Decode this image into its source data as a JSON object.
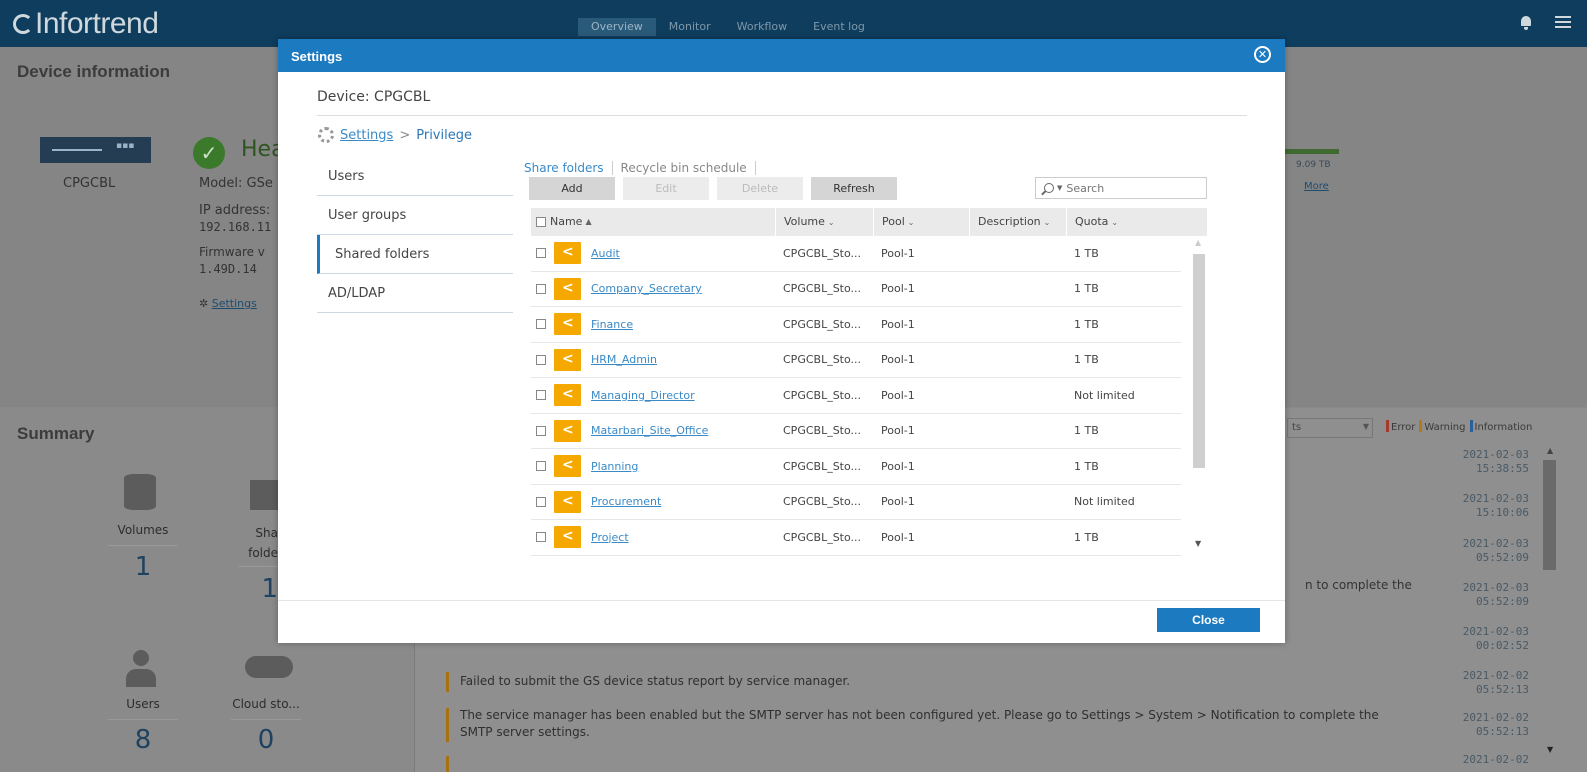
{
  "app": {
    "brand": "Infortrend",
    "nav": [
      "Overview",
      "Monitor",
      "Workflow",
      "Event log"
    ],
    "active_nav": "Overview"
  },
  "background": {
    "device_info_title": "Device information",
    "device_name": "CPGCBL",
    "health_label": "Hea",
    "model": "Model: GSe",
    "ip_label": "IP address:",
    "ip_value": "192.168.11",
    "firmware_label": "Firmware v",
    "firmware_value": "1.49D.14",
    "settings_link": "Settings",
    "capacity": "9.09 TB",
    "more_link": "More",
    "summary_title": "Summary",
    "stats": [
      {
        "label": "Volumes",
        "value": "1"
      },
      {
        "label": "Sha folde",
        "value": "1"
      },
      {
        "label": "Users",
        "value": "8"
      },
      {
        "label": "Cloud sto...",
        "value": "0"
      }
    ],
    "event_filter": "ts",
    "legend": {
      "error": "Error",
      "warning": "Warning",
      "information": "Information"
    },
    "event_times": [
      {
        "date": "2021-02-03",
        "time": "15:38:55"
      },
      {
        "date": "2021-02-03",
        "time": "15:10:06"
      },
      {
        "date": "2021-02-03",
        "time": "05:52:09"
      },
      {
        "date": "2021-02-03",
        "time": "05:52:09"
      },
      {
        "date": "2021-02-03",
        "time": "00:02:52"
      },
      {
        "date": "2021-02-02",
        "time": "05:52:13"
      },
      {
        "date": "2021-02-02",
        "time": "05:52:13"
      },
      {
        "date": "2021-02-02",
        "time": ""
      }
    ],
    "event_partial": "n to complete the",
    "events": [
      "Failed to submit the GS device status report by service manager.",
      "The service manager has been enabled but the SMTP server has not been configured yet. Please go to Settings > System > Notification to complete the",
      "SMTP server settings."
    ]
  },
  "modal": {
    "title": "Settings",
    "device_label": "Device: CPGCBL",
    "breadcrumb": {
      "root": "Settings",
      "sep": ">",
      "current": "Privilege"
    },
    "side_nav": [
      "Users",
      "User groups",
      "Shared folders",
      "AD/LDAP"
    ],
    "active_side": "Shared folders",
    "subtabs": [
      "Share folders",
      "Recycle bin schedule"
    ],
    "toolbar": {
      "add": "Add",
      "edit": "Edit",
      "delete": "Delete",
      "refresh": "Refresh"
    },
    "search": {
      "placeholder": "Search"
    },
    "columns": {
      "name": "Name",
      "volume": "Volume",
      "pool": "Pool",
      "description": "Description",
      "quota": "Quota"
    },
    "rows": [
      {
        "name": "Audit",
        "volume": "CPGCBL_Sto...",
        "pool": "Pool-1",
        "description": "",
        "quota": "1 TB"
      },
      {
        "name": "Company_Secretary",
        "volume": "CPGCBL_Sto...",
        "pool": "Pool-1",
        "description": "",
        "quota": "1 TB"
      },
      {
        "name": "Finance",
        "volume": "CPGCBL_Sto...",
        "pool": "Pool-1",
        "description": "",
        "quota": "1 TB"
      },
      {
        "name": "HRM_Admin",
        "volume": "CPGCBL_Sto...",
        "pool": "Pool-1",
        "description": "",
        "quota": "1 TB"
      },
      {
        "name": "Managing_Director",
        "volume": "CPGCBL_Sto...",
        "pool": "Pool-1",
        "description": "",
        "quota": "Not limited"
      },
      {
        "name": "Matarbari_Site_Office",
        "volume": "CPGCBL_Sto...",
        "pool": "Pool-1",
        "description": "",
        "quota": "1 TB"
      },
      {
        "name": "Planning",
        "volume": "CPGCBL_Sto...",
        "pool": "Pool-1",
        "description": "",
        "quota": "1 TB"
      },
      {
        "name": "Procurement",
        "volume": "CPGCBL_Sto...",
        "pool": "Pool-1",
        "description": "",
        "quota": "Not limited"
      },
      {
        "name": "Project",
        "volume": "CPGCBL_Sto...",
        "pool": "Pool-1",
        "description": "",
        "quota": "1 TB"
      }
    ],
    "close_label": "Close"
  }
}
